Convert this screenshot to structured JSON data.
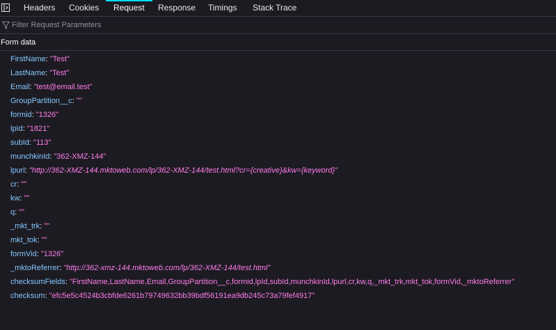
{
  "tabs": [
    {
      "label": "Headers",
      "active": false
    },
    {
      "label": "Cookies",
      "active": false
    },
    {
      "label": "Request",
      "active": true
    },
    {
      "label": "Response",
      "active": false
    },
    {
      "label": "Timings",
      "active": false
    },
    {
      "label": "Stack Trace",
      "active": false
    }
  ],
  "filter": {
    "placeholder": "Filter Request Parameters",
    "value": ""
  },
  "section": {
    "title": "Form data"
  },
  "form_data": [
    {
      "key": "FirstName",
      "value": "\"Test\"",
      "italic": false
    },
    {
      "key": "LastName",
      "value": "\"Test\"",
      "italic": false
    },
    {
      "key": "Email",
      "value": "\"test@email.test\"",
      "italic": false
    },
    {
      "key": "GroupPartition__c",
      "value": "\"\"",
      "italic": false
    },
    {
      "key": "formid",
      "value": "\"1326\"",
      "italic": false
    },
    {
      "key": "lpId",
      "value": "\"1821\"",
      "italic": false
    },
    {
      "key": "subId",
      "value": "\"113\"",
      "italic": false
    },
    {
      "key": "munchkinId",
      "value": "\"362-XMZ-144\"",
      "italic": false
    },
    {
      "key": "lpurl",
      "value": "\"http://362-XMZ-144.mktoweb.com/lp/362-XMZ-144/test.html?cr={creative}&kw={keyword}\"",
      "italic": true
    },
    {
      "key": "cr",
      "value": "\"\"",
      "italic": false
    },
    {
      "key": "kw",
      "value": "\"\"",
      "italic": false
    },
    {
      "key": "q",
      "value": "\"\"",
      "italic": false
    },
    {
      "key": "_mkt_trk",
      "value": "\"\"",
      "italic": false
    },
    {
      "key": "mkt_tok",
      "value": "\"\"",
      "italic": false
    },
    {
      "key": "formVid",
      "value": "\"1326\"",
      "italic": false
    },
    {
      "key": "_mktoReferrer",
      "value": "\"http://362-xmz-144.mktoweb.com/lp/362-XMZ-144/test.html\"",
      "italic": true
    },
    {
      "key": "checksumFields",
      "value": "\"FirstName,LastName,Email,GroupPartition__c,formid,lpId,subId,munchkinId,lpurl,cr,kw,q,_mkt_trk,mkt_tok,formVid,_mktoReferrer\"",
      "italic": false
    },
    {
      "key": "checksum",
      "value": "\"efc5e5c4524b3cbfde6261b79749632bb39bdf56191ea9db245c73a79fef4917\"",
      "italic": false
    }
  ],
  "colors": {
    "background": "#1c1b22",
    "key": "#86c8ff",
    "value": "#ff7de9",
    "active_tab_indicator": "#00ddff"
  },
  "icons": {
    "panel_toggle": "dock-side-icon",
    "filter": "filter-funnel-icon"
  }
}
